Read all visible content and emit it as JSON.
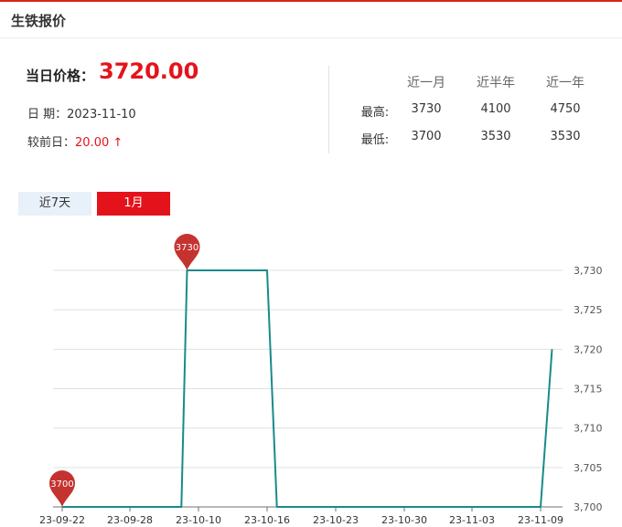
{
  "title": "生铁报价",
  "price": {
    "label": "当日价格：",
    "value": "3720.00"
  },
  "date": {
    "label": "日 期：",
    "value": "2023-11-10"
  },
  "diff": {
    "label": "较前日：",
    "value": "20.00 ↑"
  },
  "stats": {
    "headers": [
      "近一月",
      "近半年",
      "近一年"
    ],
    "rows": [
      {
        "label": "最高:",
        "values": [
          "3730",
          "4100",
          "4750"
        ]
      },
      {
        "label": "最低:",
        "values": [
          "3700",
          "3530",
          "3530"
        ]
      }
    ]
  },
  "tabs": [
    {
      "label": "近7天",
      "active": false
    },
    {
      "label": "1月",
      "active": true
    }
  ],
  "colors": {
    "accent": "#e4131b",
    "line": "#1a8a8a",
    "marker": "#c53330",
    "tab_inactive": "#e8f0f9"
  },
  "chart_data": {
    "type": "line",
    "x_labels": [
      "23-09-22",
      "23-09-28",
      "23-10-10",
      "23-10-16",
      "23-10-23",
      "23-10-30",
      "23-11-03",
      "23-11-09"
    ],
    "y_ticks": [
      3700,
      3705,
      3710,
      3715,
      3720,
      3725,
      3730
    ],
    "y_tick_labels": [
      "3,700",
      "3,705",
      "3,710",
      "3,715",
      "3,720",
      "3,725",
      "3,730"
    ],
    "ylim": [
      3700,
      3730
    ],
    "grid": true,
    "series": [
      {
        "name": "",
        "x": [
          "23-09-22",
          "23-09-25",
          "23-09-26",
          "23-09-27",
          "23-09-28",
          "23-10-07",
          "23-10-08",
          "23-10-09",
          "23-10-10",
          "23-10-11",
          "23-10-12",
          "23-10-13",
          "23-10-16",
          "23-10-17",
          "23-10-18",
          "23-10-19",
          "23-10-20",
          "23-10-23",
          "23-10-24",
          "23-10-25",
          "23-10-26",
          "23-10-27",
          "23-10-30",
          "23-10-31",
          "23-11-01",
          "23-11-02",
          "23-11-03",
          "23-11-06",
          "23-11-07",
          "23-11-08",
          "23-11-09",
          "23-11-10"
        ],
        "values": [
          3700,
          3700,
          3700,
          3700,
          3700,
          3700,
          3730,
          3730,
          3730,
          3730,
          3730,
          3730,
          3730,
          3700,
          3700,
          3700,
          3700,
          3700,
          3700,
          3700,
          3700,
          3700,
          3700,
          3700,
          3700,
          3700,
          3700,
          3700,
          3700,
          3700,
          3700,
          3720
        ]
      }
    ],
    "markers": [
      {
        "label": "3730",
        "x": "23-10-08",
        "value": 3730
      },
      {
        "label": "3700",
        "x": "23-09-22",
        "value": 3700
      }
    ]
  }
}
